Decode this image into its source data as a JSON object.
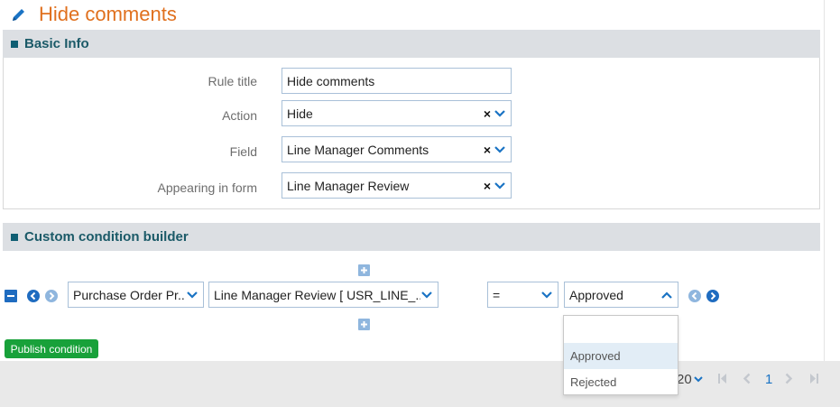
{
  "header": {
    "title": "Hide comments"
  },
  "basic_info": {
    "heading": "Basic Info",
    "rule_title": {
      "label": "Rule title",
      "value": "Hide comments"
    },
    "action": {
      "label": "Action",
      "value": "Hide",
      "clear": "×"
    },
    "field": {
      "label": "Field",
      "value": "Line Manager Comments",
      "clear": "×"
    },
    "form": {
      "label": "Appearing in form",
      "value": "Line Manager Review",
      "clear": "×"
    }
  },
  "condition_builder": {
    "heading": "Custom condition builder",
    "row": {
      "source": "Purchase Order Pr...",
      "field": "Line Manager Review [ USR_LINE_...",
      "operator": "=",
      "value": "Approved"
    },
    "options": [
      "Approved",
      "Rejected"
    ],
    "highlighted_option": "Approved",
    "publish_label": "Publish condition"
  },
  "pager": {
    "page_size": "20",
    "current_page": "1"
  },
  "colors": {
    "accent_orange": "#e0701e",
    "section_text": "#1b5a68",
    "link_blue": "#1a73c4",
    "publish_green": "#18a13a"
  }
}
